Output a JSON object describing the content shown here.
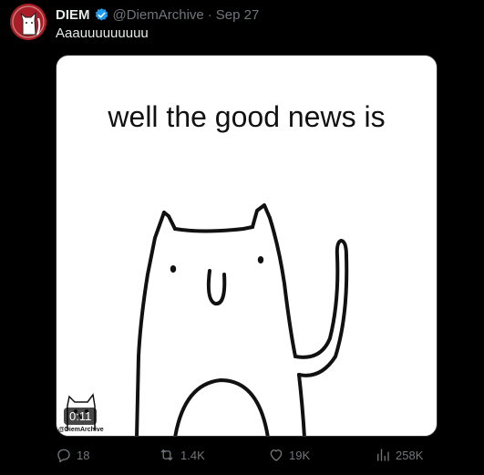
{
  "tweet": {
    "author_name": "DIEM",
    "verified": true,
    "handle": "@DiemArchive",
    "separator": "·",
    "date": "Sep 27",
    "text": "Aaauuuuuuuuu"
  },
  "media": {
    "caption": "well the good news is",
    "watermark": "@DiemArchive",
    "duration": "0:11"
  },
  "actions": {
    "replies": "18",
    "reposts": "1.4K",
    "likes": "19K",
    "views": "258K"
  },
  "colors": {
    "background": "#000000",
    "text_primary": "#e7e9ea",
    "text_secondary": "#71767b",
    "verified_blue": "#1d9bf0",
    "avatar_red": "#b0202a"
  },
  "icons": [
    "verified-badge-icon",
    "reply-icon",
    "repost-icon",
    "like-icon",
    "views-icon"
  ]
}
